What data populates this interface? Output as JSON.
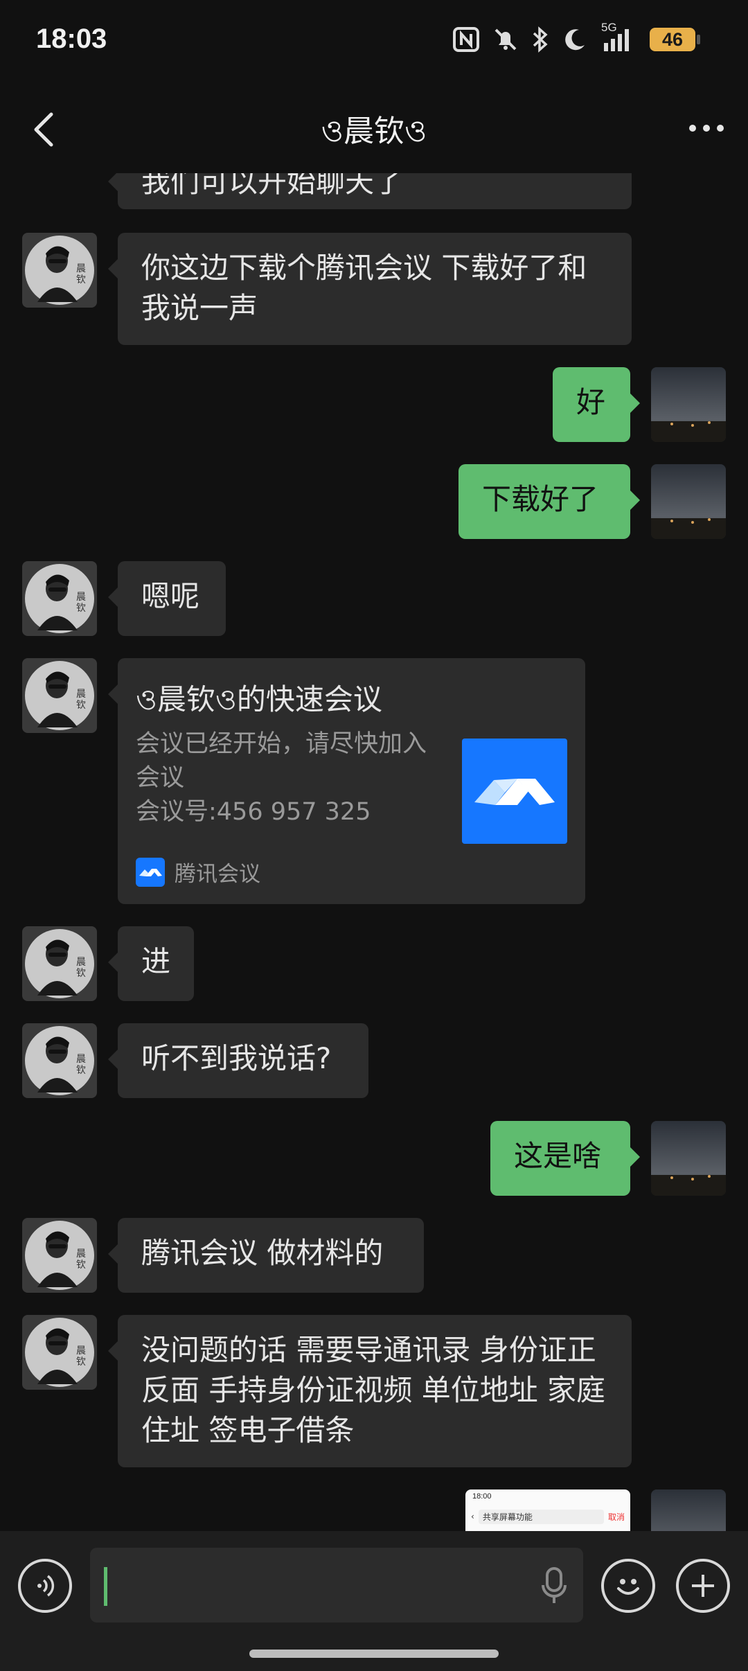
{
  "status_bar": {
    "time": "18:03",
    "network": "5G",
    "battery": "46",
    "icons": [
      "nfc-icon",
      "mute-icon",
      "bluetooth-icon",
      "moon-icon",
      "signal-icon",
      "battery-icon"
    ]
  },
  "header": {
    "title": "ও晨钦ও",
    "back_icon": "chevron-left-icon",
    "more_icon": "more-dots-icon"
  },
  "messages": [
    {
      "side": "in",
      "text": "我们可以开始聊天了"
    },
    {
      "side": "in",
      "text": "你这边下载个腾讯会议 下载好了和我说一声"
    },
    {
      "side": "out",
      "text": "好"
    },
    {
      "side": "out",
      "text": "下载好了"
    },
    {
      "side": "in",
      "text": "嗯呢"
    },
    {
      "side": "in",
      "type": "card",
      "card": {
        "title": "ও晨钦ও的快速会议",
        "desc_line1": "会议已经开始，请尽快加入会议",
        "desc_line2": "会议号:456 957 325",
        "source": "腾讯会议",
        "accent": "#1677ff"
      }
    },
    {
      "side": "in",
      "text": "进"
    },
    {
      "side": "in",
      "text": "听不到我说话?"
    },
    {
      "side": "out",
      "text": "这是啥"
    },
    {
      "side": "in",
      "text": "腾讯会议 做材料的"
    },
    {
      "side": "in",
      "text": "没问题的话 需要导通讯录 身份证正反面 手持身份证视频 单位地址 家庭住址 签电子借条"
    },
    {
      "side": "out",
      "type": "image",
      "image": {
        "time": "18:00",
        "search_text": "共享屏幕功能",
        "search_button": "取消"
      }
    }
  ],
  "input_bar": {
    "voice_icon": "voice-mode-icon",
    "mic_icon": "mic-icon",
    "emoji_icon": "emoji-icon",
    "plus_icon": "plus-icon",
    "value": ""
  },
  "colors": {
    "background": "#111111",
    "bubble_in": "#2c2c2c",
    "bubble_out": "#5fbc6f",
    "accent_green": "#5fbc6f"
  }
}
